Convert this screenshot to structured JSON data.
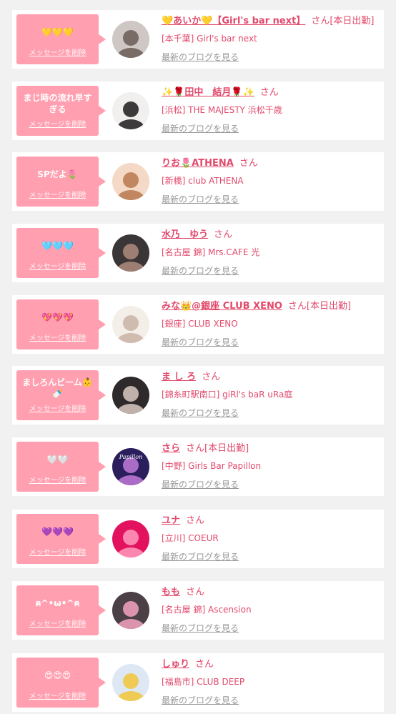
{
  "delete_label": "メッセージを削除",
  "blog_label": "最新のブログを見る",
  "colors": {
    "bubble": "#ff9fb0",
    "accent": "#e2496b",
    "link_gray": "#999999",
    "background": "#f1f1f1"
  },
  "messages": [
    {
      "message": "💛💛💛",
      "name": "💛あいか💛【Girl's bar next】",
      "san": "さん",
      "today": "[本日出勤]",
      "shop": "[本千葉] Girl's bar next",
      "avatar_colors": [
        "#cfc7c3",
        "#6a5a55"
      ]
    },
    {
      "message": "まじ時の流れ早すぎる",
      "name": "✨🌹田中　結月🌹✨",
      "san": "さん",
      "today": "",
      "shop": "[浜松] THE MAJESTY 浜松千歳",
      "avatar_colors": [
        "#f2f0ee",
        "#1c1a1a"
      ]
    },
    {
      "message": "SPだよ🌷",
      "name": "りお🌷ATHENA",
      "san": "さん",
      "today": "",
      "shop": "[新橋] club ATHENA",
      "avatar_colors": [
        "#f3d9c6",
        "#b8774e"
      ]
    },
    {
      "message": "🩵🩵🩵",
      "name": "水乃　ゆう",
      "san": "さん",
      "today": "",
      "shop": "[名古屋 錦] Mrs.CAFE 光",
      "avatar_colors": [
        "#3a3536",
        "#b08b7d"
      ]
    },
    {
      "message": "💖💖💖",
      "name": "みな👑@銀座 CLUB XENO",
      "san": "さん",
      "today": "[本日出勤]",
      "shop": "[銀座] CLUB XENO",
      "avatar_colors": [
        "#f4eee9",
        "#c9b2a4"
      ]
    },
    {
      "message": "ましろんビーム👶🍼",
      "name": "ま し ろ",
      "san": "さん",
      "today": "",
      "shop": "[錦糸町駅南口] giRl's baR uRa庭",
      "avatar_colors": [
        "#2e2a2b",
        "#d9c9c1"
      ]
    },
    {
      "message": "🤍🤍",
      "name": "さら",
      "san": "さん",
      "today": "[本日出勤]",
      "shop": "[中野] Girls Bar Papillon",
      "avatar_colors": [
        "#2a1e5c",
        "#c27ad9"
      ],
      "avatar_text": "Papillon"
    },
    {
      "message": "💜💜💜",
      "name": "ユナ",
      "san": "さん",
      "today": "",
      "shop": "[立川] COEUR",
      "avatar_colors": [
        "#e3125e",
        "#ff9cc0"
      ]
    },
    {
      "message": "ฅ^•ω•^ฅ",
      "name": "もも",
      "san": "さん",
      "today": "",
      "shop": "[名古屋 錦] Ascension",
      "avatar_colors": [
        "#4b4045",
        "#f5a3c0"
      ]
    },
    {
      "message": "😍😍😍",
      "name": "しゅり",
      "san": "さん",
      "today": "",
      "shop": "[福島市] CLUB DEEP",
      "avatar_colors": [
        "#dde8f4",
        "#f2c63a"
      ]
    }
  ]
}
